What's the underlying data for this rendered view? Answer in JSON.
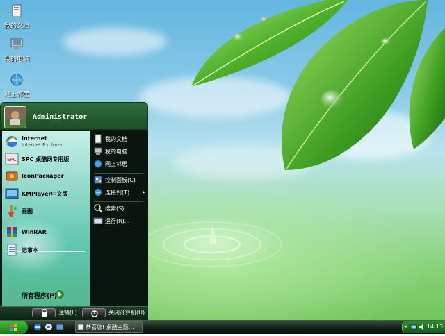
{
  "desktop": {
    "icons": [
      {
        "label": "我的文档",
        "icon": "my-documents-icon"
      },
      {
        "label": "我的电脑",
        "icon": "my-computer-icon"
      },
      {
        "label": "网上邻居",
        "icon": "network-places-icon"
      }
    ]
  },
  "start_menu": {
    "username": "Administrator",
    "pinned": [
      {
        "title": "Internet",
        "subtitle": "Internet Explorer",
        "icon": "internet-explorer-icon"
      },
      {
        "title": "SPC 桌酷网专用版",
        "icon": "spc-icon"
      },
      {
        "title": "IconPackager",
        "icon": "iconpackager-icon"
      },
      {
        "title": "KMPlayer中文版",
        "icon": "kmplayer-icon"
      },
      {
        "title": "画图",
        "icon": "paint-icon"
      }
    ],
    "recent": [
      {
        "title": "WinRAR",
        "icon": "winrar-icon"
      },
      {
        "title": "记事本",
        "icon": "notepad-icon"
      }
    ],
    "all_programs": "所有程序(P)",
    "right": [
      {
        "label": "我的文档",
        "icon": "my-documents-icon"
      },
      {
        "label": "我的电脑",
        "icon": "my-computer-icon"
      },
      {
        "label": "网上邻居",
        "icon": "network-places-icon"
      },
      {
        "label": "控制面板(C)",
        "icon": "control-panel-icon"
      },
      {
        "label": "连接到(T)",
        "icon": "connect-to-icon"
      },
      {
        "label": "搜索(S)",
        "icon": "search-icon"
      },
      {
        "label": "运行(R)...",
        "icon": "run-icon"
      }
    ],
    "logoff": "注销(L)",
    "shutdown": "关闭计算机(U)"
  },
  "taskbar": {
    "task_item": "恭喜您! 桌酷主题...",
    "clock": "14:13"
  },
  "colors": {
    "menu_header": "#2f6e3b",
    "menu_dark": "#0c1a12",
    "taskbar": "#172218",
    "tray": "#2f8a34"
  }
}
